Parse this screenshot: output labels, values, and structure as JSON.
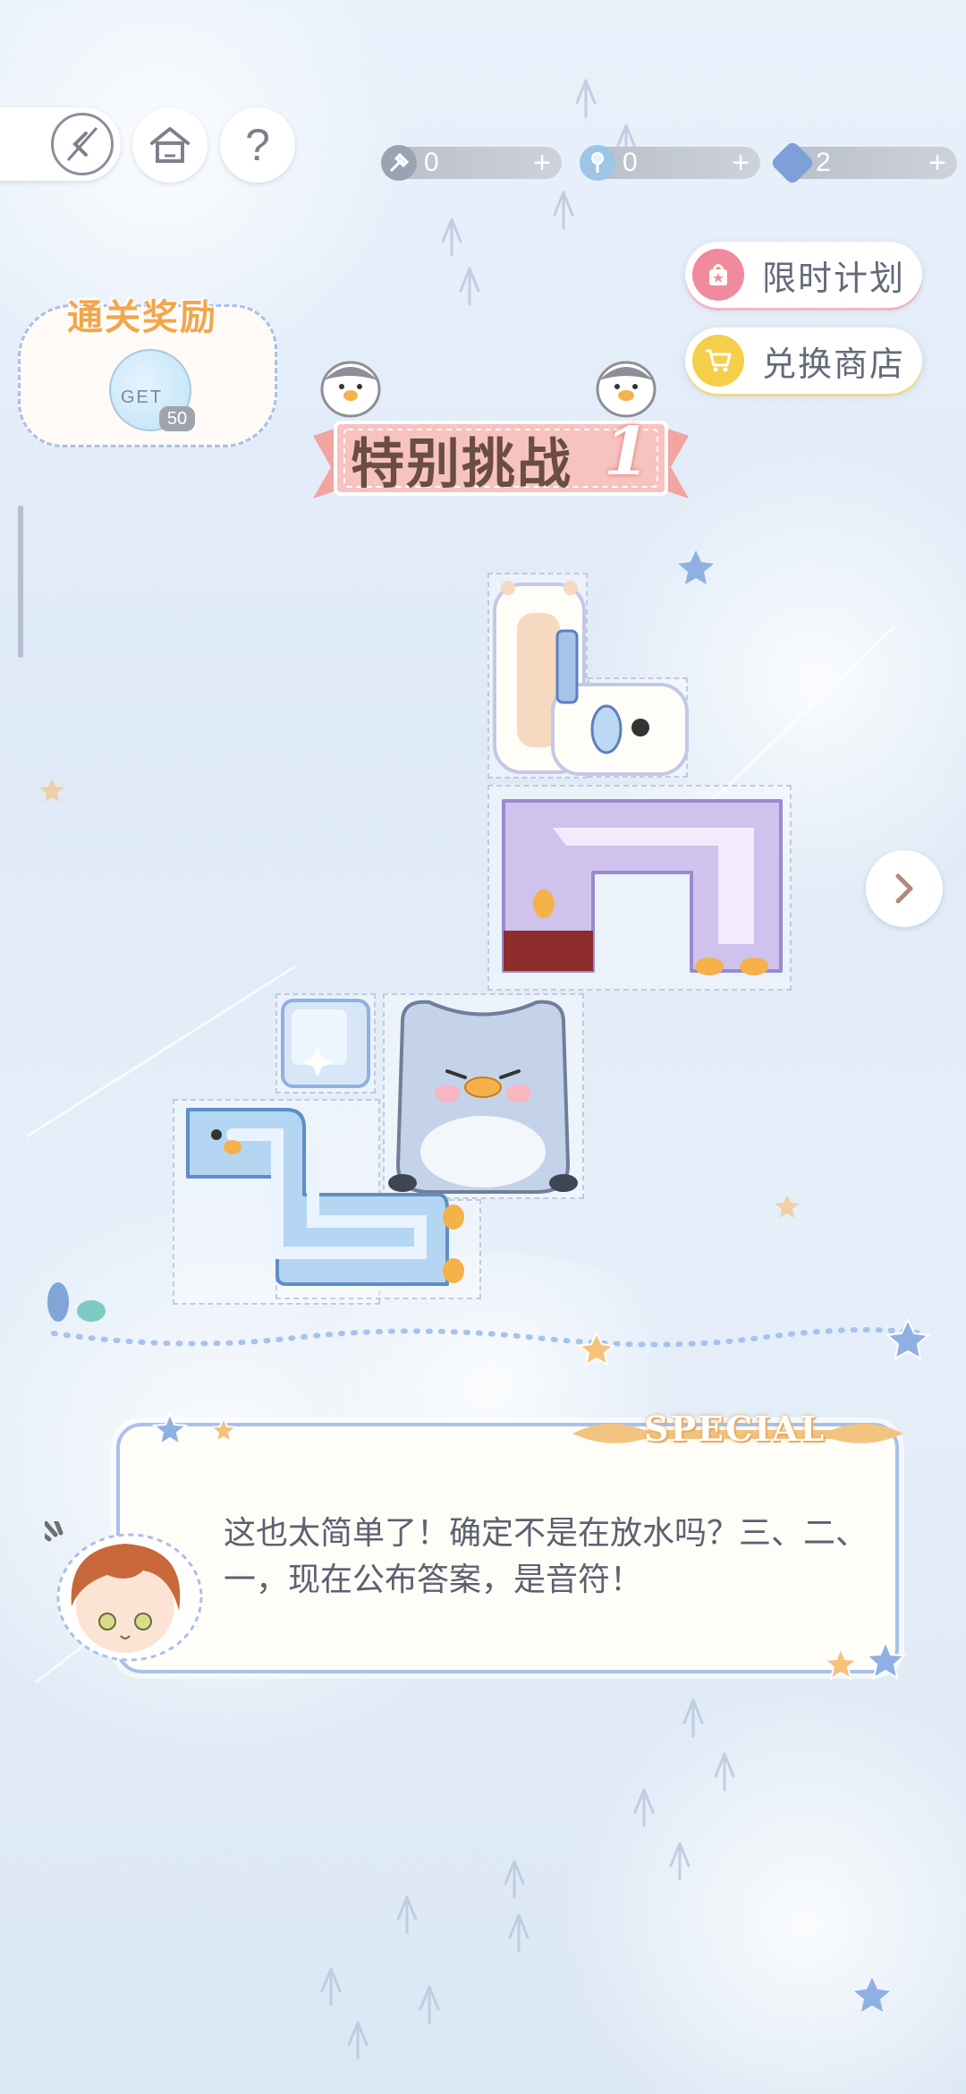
{
  "nav": {
    "back_icon": "back-arrow-icon",
    "home_icon": "home-icon",
    "help_glyph": "?"
  },
  "resources": [
    {
      "icon": "shovel-icon",
      "count": "0",
      "plus": "+"
    },
    {
      "icon": "key-icon",
      "count": "0",
      "plus": "+"
    },
    {
      "icon": "gem-card-icon",
      "count": "2",
      "plus": "+"
    }
  ],
  "side_buttons": {
    "limited_plan": "限时计划",
    "exchange_shop": "兑换商店"
  },
  "reward": {
    "title": "通关奖励",
    "get_label": "GET",
    "count": "50"
  },
  "banner": {
    "title": "特别挑战",
    "number": "1"
  },
  "dialog": {
    "badge": "SPECIAL",
    "text": "这也太简单了！确定不是在放水吗？三、二、一，现在公布答案，是音符！"
  },
  "colors": {
    "accent_pink": "#f08a9c",
    "accent_yellow": "#f5cf4a",
    "bg": "#e6eff9",
    "dialog_border": "#a9c0ea"
  }
}
